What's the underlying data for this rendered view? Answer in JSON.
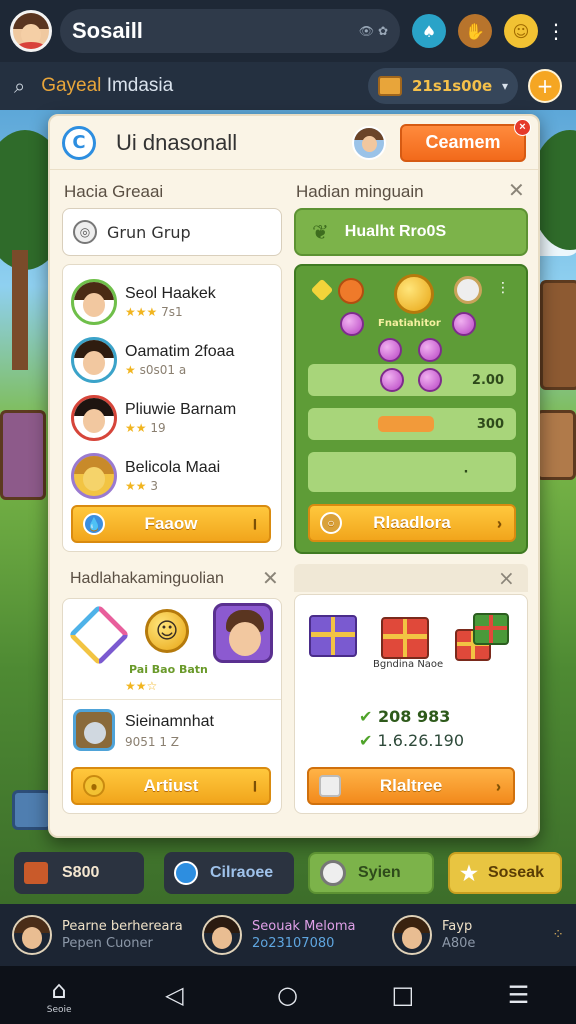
{
  "topbar": {
    "title": "Sosaill",
    "mini_text": "👁 ✿",
    "icons": [
      "spade-icon",
      "hand-icon",
      "smile-icon"
    ],
    "menu_glyph": "⋮"
  },
  "secondbar": {
    "label_a": "Gayeal",
    "label_b": "Imdasia",
    "coins": "21s1s00e",
    "caret": "▾",
    "plus": "+"
  },
  "panel": {
    "title": "Ui dnasonall",
    "cta": "Ceamem",
    "badge_x": "×",
    "left_section_label": "Hacia Greaai",
    "right_section_label": "Hadian minguain",
    "group_input": "Grun Grup",
    "green_head": "Hualht Rro0S",
    "friends": [
      {
        "name": "Seol Haakek",
        "stars": "★★★",
        "stat": "7s1",
        "hair": "#4a2a14",
        "ring": "#6fbf4a"
      },
      {
        "name": "Oamatim 2foaa",
        "stars": "★",
        "stat": "s0s01 a",
        "hair": "#2f1c0f",
        "ring": "#3ba3c9"
      },
      {
        "name": "Pliuwie Barnam",
        "stars": "★★",
        "stat": "19",
        "hair": "#1e1410",
        "ring": "#d6453a"
      },
      {
        "name": "Belicola Maai",
        "stars": "★★",
        "stat": "3",
        "hair": "#c88a2a",
        "ring": "#9a7ad0"
      }
    ],
    "follow_btn": "Faaow",
    "follow_tail": "I",
    "board_center_label": "Fnatiahitor",
    "board_rows": [
      "2.00",
      "300",
      "·"
    ],
    "board_btn": "Rlaadlora",
    "board_btn_tail": "›",
    "bottom_left_label": "Hadlahakaminguolian",
    "bottom_right_x": "×",
    "pet_label": "Pai Bao Batn",
    "pet_stars": "★★☆",
    "person_name": "Sieinamnhat",
    "person_stat": "9051 1 Z",
    "artist_btn": "Artiust",
    "artist_tail": "I",
    "gifts_label": "Bgndina Naoe",
    "check_1": "208 983",
    "check_2": "1.6.26.190",
    "release_btn": "Rlaltree",
    "release_tail": "›"
  },
  "tiles": [
    {
      "label": "S800",
      "color": "#f5e7d0",
      "bg": "#2b3340"
    },
    {
      "label": "Cilraoee",
      "color": "#9fc2ea",
      "bg": "#2b3340"
    },
    {
      "label": "Syien",
      "color": "#2e4a1b",
      "bg": "#7cb34a"
    },
    {
      "label": "Soseak",
      "color": "#5a3d05",
      "bg": "#e8c541"
    }
  ],
  "social": [
    {
      "l1": "Pearne berhereara",
      "l2": "Pepen Cuoner"
    },
    {
      "l1": "Seouak Meloma",
      "l2": "2o23107080"
    },
    {
      "l1": "Fayp",
      "l2": "A80e"
    }
  ],
  "navbar": {
    "home_caption": "Seoie"
  },
  "colors": {
    "accent_orange": "#f26a1b",
    "accent_yellow": "#f1a51c",
    "board_green": "#5e9c37",
    "panel_bg": "#faf4e6"
  }
}
